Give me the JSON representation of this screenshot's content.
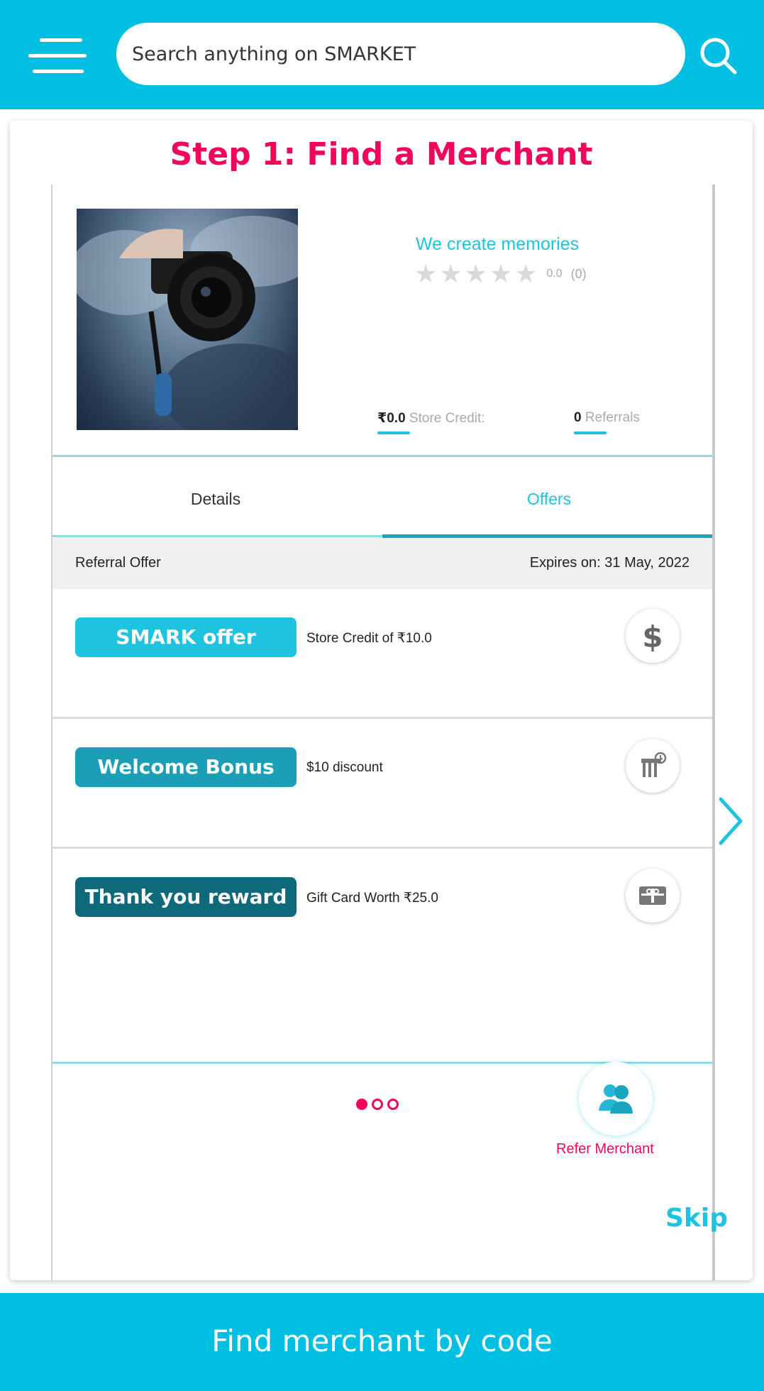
{
  "header": {
    "search_placeholder": "Search anything on SMARKET"
  },
  "card": {
    "step_title": "Step 1: Find a Merchant"
  },
  "merchant": {
    "name": "We create memories",
    "rating_value": "0.0",
    "rating_count": "(0)",
    "store_credit_value": "₹0.0",
    "store_credit_label": "Store Credit:",
    "referrals_value": "0",
    "referrals_label": "Referrals"
  },
  "tabs": {
    "details": "Details",
    "offers": "Offers",
    "active": "Offers"
  },
  "offers_header": {
    "left": "Referral Offer",
    "right": "Expires on: 31 May, 2022"
  },
  "offers": [
    {
      "badge": "SMARK offer",
      "description": "Store Credit of ₹10.0",
      "color": "#1ec3df",
      "icon": "dollar-icon"
    },
    {
      "badge": "Welcome Bonus",
      "description": "$10 discount",
      "color": "#1a9fb7",
      "icon": "store-icon"
    },
    {
      "badge": "Thank you reward",
      "description": "Gift Card Worth ₹25.0",
      "color": "#0e6a7a",
      "icon": "gift-card-icon"
    }
  ],
  "pagination": {
    "current": 1,
    "total": 3
  },
  "refer_merchant_label": "Refer Merchant",
  "skip_label": "Skip",
  "footer": {
    "find_by_code": "Find merchant by code"
  },
  "colors": {
    "brand": "#00bfe0",
    "accent": "#f0065c"
  }
}
